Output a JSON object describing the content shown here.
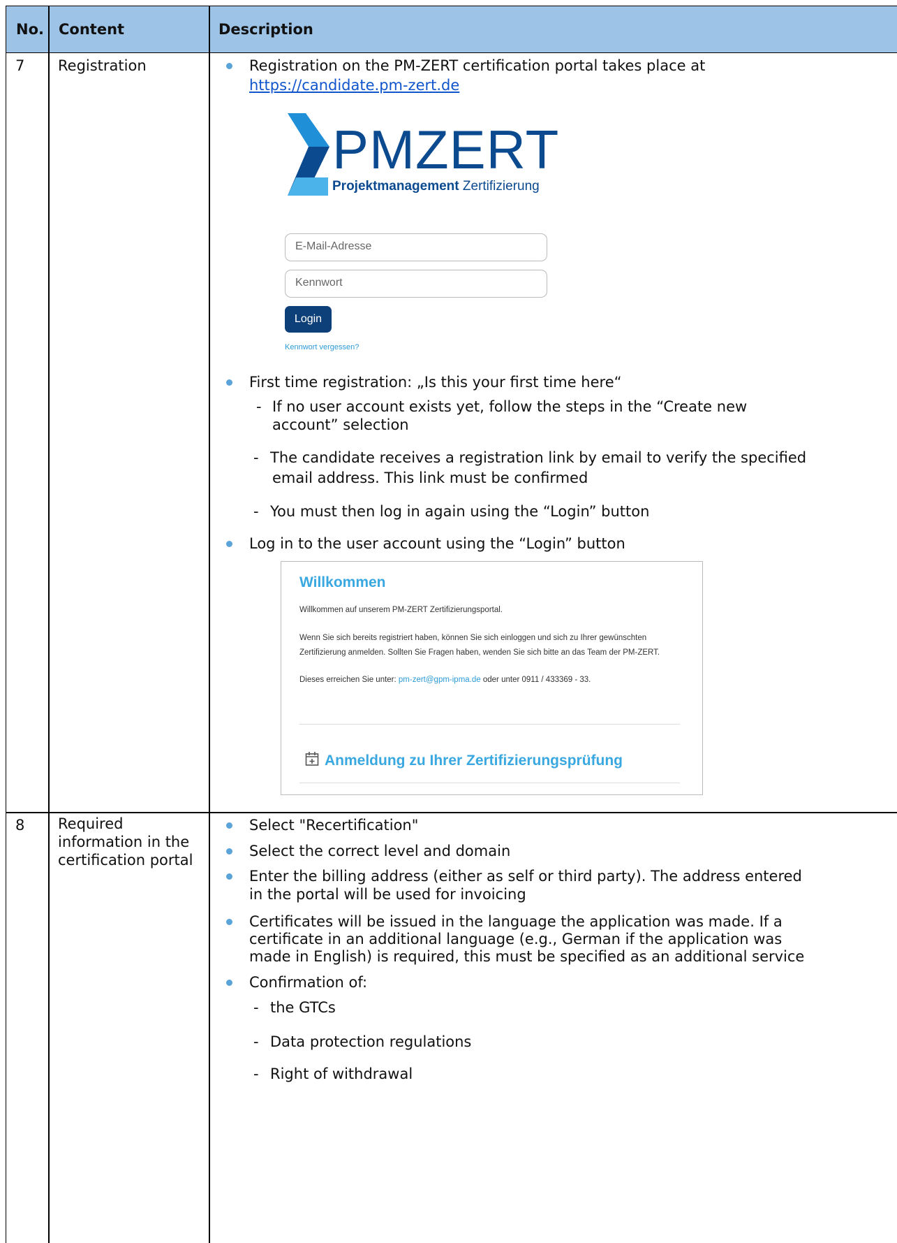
{
  "header": {
    "col_no": "No.",
    "col_content": "Content",
    "col_description": "Description"
  },
  "row7": {
    "no": "7",
    "content": "Registration",
    "bullet1_text": "Registration on the PM-ZERT certification portal takes place at",
    "bullet1_link": "https://candidate.pm-zert.de",
    "login": {
      "logo_text": "PMZERT",
      "logo_sub_bold": "Projektmanagement",
      "logo_sub_rest": " Zertifizierung",
      "email_placeholder": "E-Mail-Adresse",
      "password_placeholder": "Kennwort",
      "login_button": "Login",
      "forgot_link": "Kennwort vergessen?"
    },
    "bullet2": "First time registration: „Is this your first time here“",
    "sub1_line1": "If no user account exists yet, follow the steps in the “Create new",
    "sub1_line2": "account” selection",
    "sub2_line1": "The candidate receives a registration link by email to verify the specified",
    "sub2_line2": "email address. This link must be confirmed",
    "sub3": "You must then log in again using the “Login” button",
    "bullet3": "Log in to the user account using the “Login” button",
    "welcome": {
      "title": "Willkommen",
      "p1": "Willkommen auf unserem PM-ZERT Zertifizierungsportal.",
      "p2_line1": "Wenn Sie sich bereits registriert haben, können Sie sich einloggen und sich zu Ihrer gewünschten",
      "p2_line2": "Zertifizierung anmelden. Sollten Sie Fragen haben, wenden Sie sich bitte an das Team der PM-ZERT.",
      "p3_pre": "Dieses erreichen Sie unter: ",
      "p3_email": "pm-zert@gpm-ipma.de",
      "p3_post": " oder unter 0911 / 433369 - 33.",
      "cta": "Anmeldung zu Ihrer Zertifizierungsprüfung"
    }
  },
  "row8": {
    "no": "8",
    "content_line1": "Required",
    "content_line2": "information in the",
    "content_line3": "certification portal",
    "b1": "Select \"Recertification\"",
    "b2": "Select the correct level and domain",
    "b3_line1": "Enter the billing address (either as self or third party). The address entered",
    "b3_line2": "in the portal will be used for invoicing",
    "b4_line1": "Certificates will be issued in the language the application was made. If a",
    "b4_line2": "certificate in an additional language (e.g., German if the application was",
    "b4_line3": "made in English) is required, this must be specified as an additional service",
    "b5": "Confirmation of:",
    "s1": "the GTCs",
    "s2": "Data protection regulations",
    "s3": "Right of withdrawal"
  }
}
